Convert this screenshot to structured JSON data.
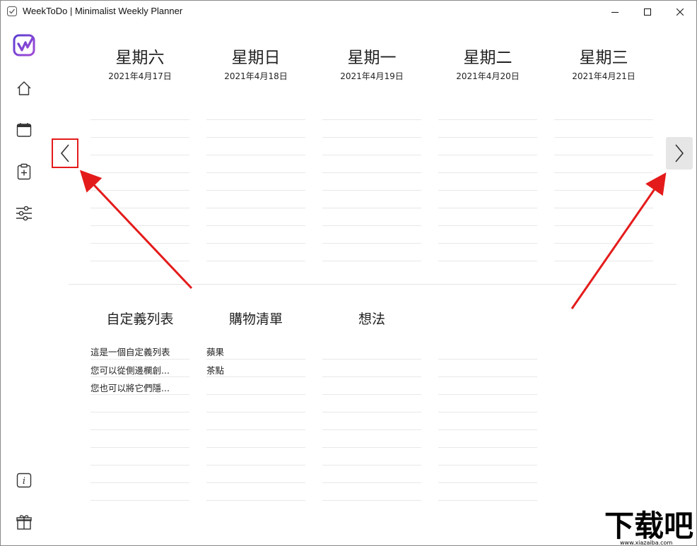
{
  "window": {
    "title": "WeekToDo | Minimalist Weekly Planner"
  },
  "sidebar": {
    "items": [
      {
        "icon": "logo-icon"
      },
      {
        "icon": "home-icon"
      },
      {
        "icon": "calendar-icon"
      },
      {
        "icon": "clipboard-add-icon"
      },
      {
        "icon": "sliders-icon"
      },
      {
        "icon": "info-icon"
      },
      {
        "icon": "gift-icon"
      }
    ]
  },
  "days": [
    {
      "name": "星期六",
      "date": "2021年4月17日"
    },
    {
      "name": "星期日",
      "date": "2021年4月18日"
    },
    {
      "name": "星期一",
      "date": "2021年4月19日"
    },
    {
      "name": "星期二",
      "date": "2021年4月20日"
    },
    {
      "name": "星期三",
      "date": "2021年4月21日"
    }
  ],
  "lists": [
    {
      "title": "自定義列表",
      "items": [
        "這是一個自定義列表",
        "您可以從側邊欄創...",
        "您也可以將它們隱..."
      ]
    },
    {
      "title": "購物清單",
      "items": [
        "蘋果",
        "茶點"
      ]
    },
    {
      "title": "想法",
      "items": []
    },
    {
      "title": "",
      "items": []
    }
  ],
  "watermark": {
    "text": "下载吧",
    "url": "www.xiazaiba.com"
  },
  "colors": {
    "accent": "#7a4fd6",
    "annotation": "#e41b1b"
  }
}
